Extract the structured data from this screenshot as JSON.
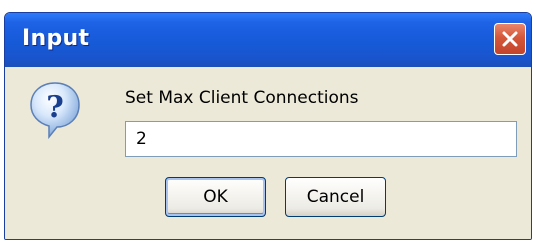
{
  "dialog": {
    "title": "Input",
    "close_icon": "close-icon",
    "icon": "question-icon",
    "prompt": "Set Max Client Connections",
    "input_value": "2",
    "buttons": {
      "ok_label": "OK",
      "cancel_label": "Cancel"
    }
  },
  "colors": {
    "titlebar": "#165ad8",
    "close_button": "#d5573a",
    "dialog_background": "#ece9d8",
    "input_border": "#7f9db9",
    "button_border": "#003c74"
  }
}
